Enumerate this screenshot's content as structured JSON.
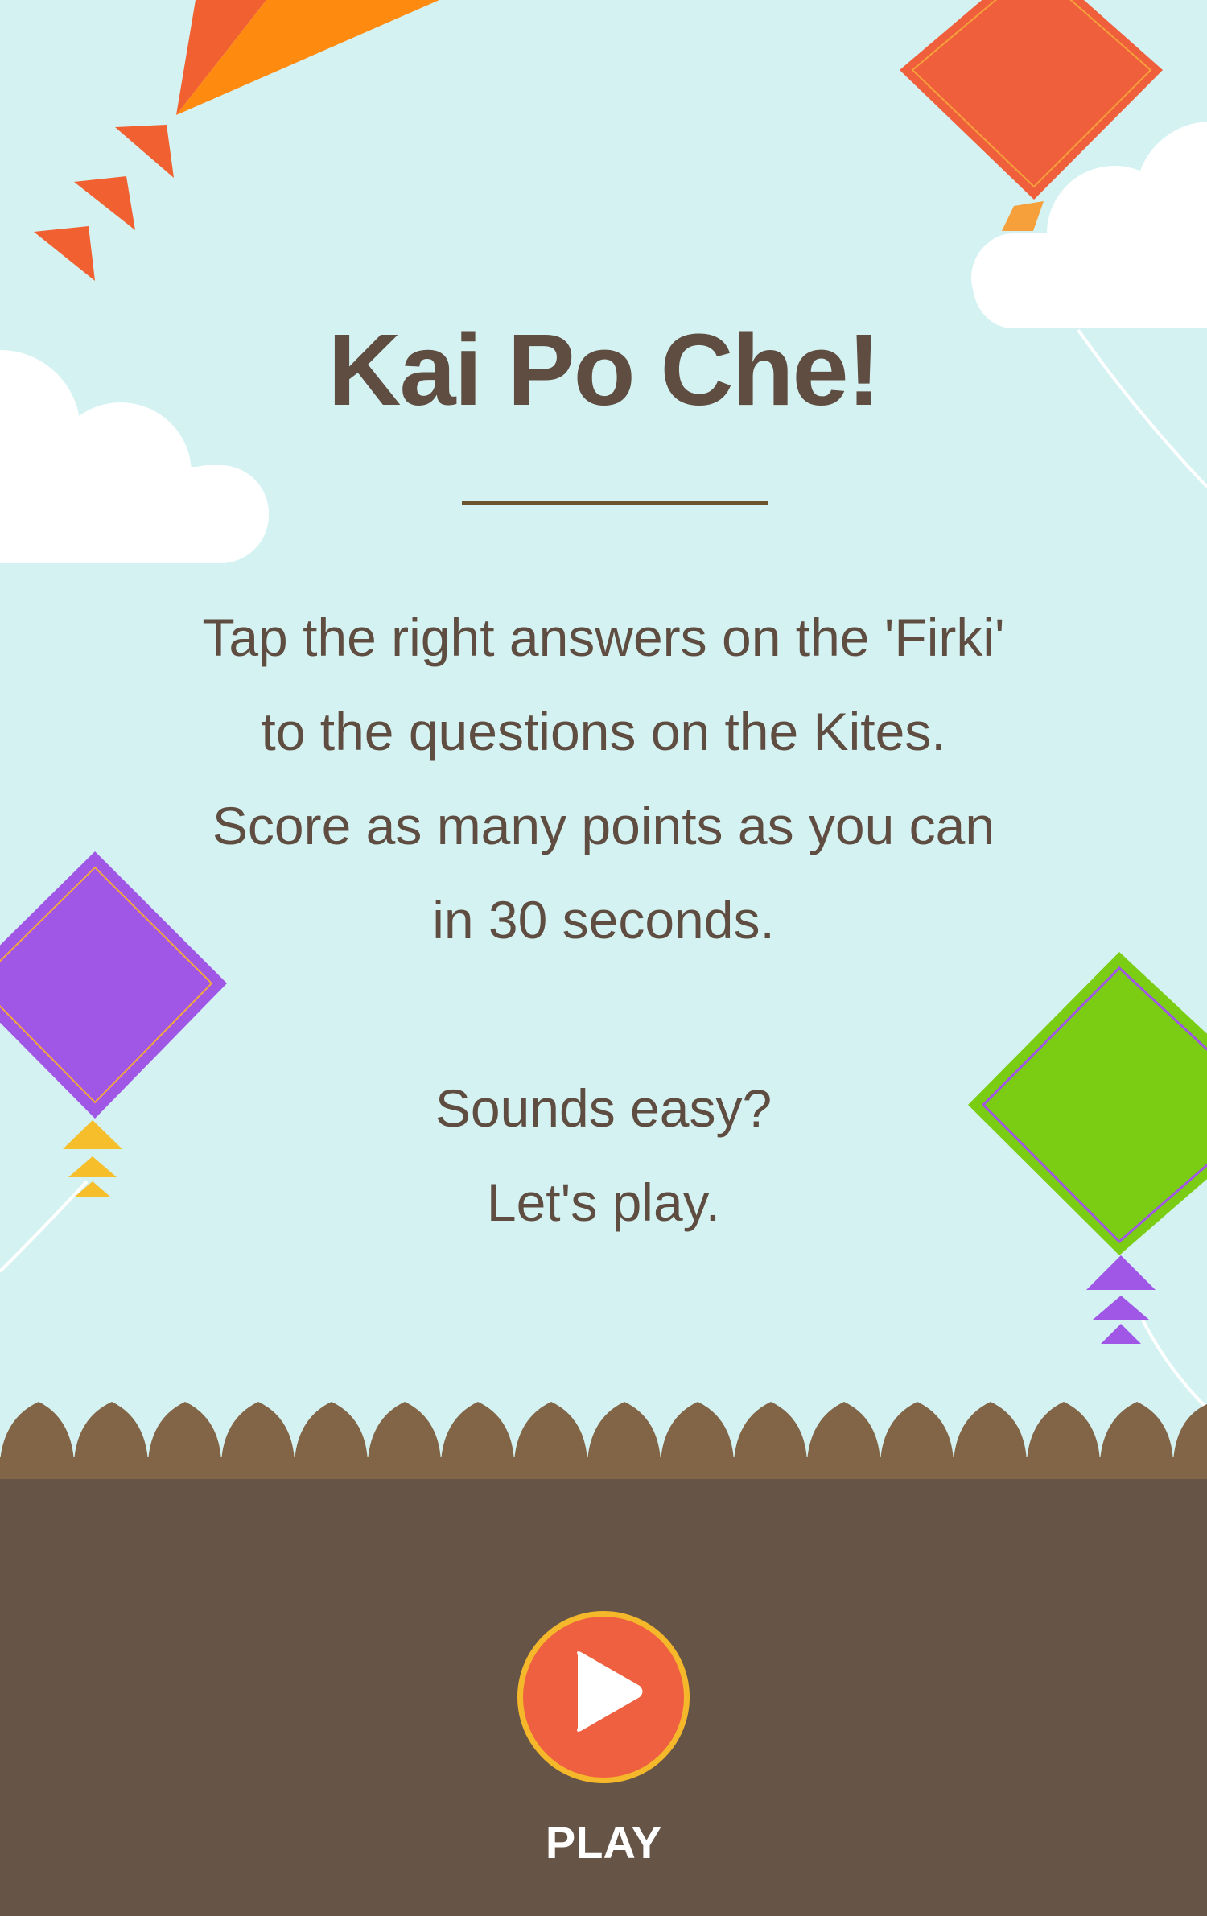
{
  "game": {
    "title": "Kai Po Che!",
    "instructions": {
      "lines": [
        "Tap the right answers on the 'Firki'",
        "to the questions on the Kites.",
        "Score as many points as you can",
        "in 30 seconds."
      ],
      "outro": [
        "Sounds easy?",
        "Let's play."
      ]
    },
    "play_button": {
      "icon": "play-icon",
      "label": "PLAY"
    }
  },
  "colors": {
    "sky": "#d4f2f2",
    "ground": "#665547",
    "fence": "#826446",
    "text": "#5e4d40",
    "play_button_fill": "#ee6040",
    "play_button_ring": "#f5b82a"
  }
}
